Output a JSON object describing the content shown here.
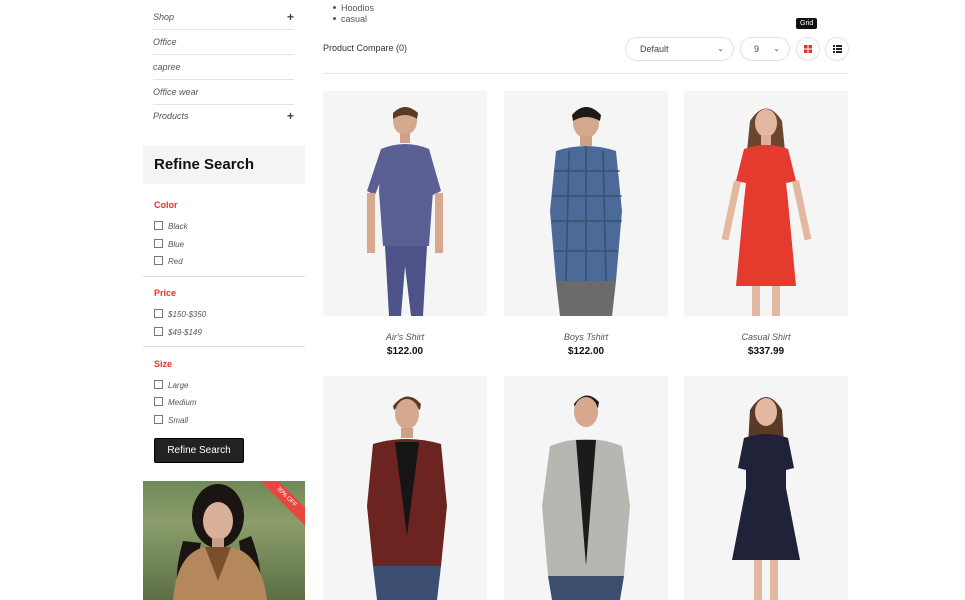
{
  "sidebar": {
    "categories": [
      {
        "label": "Shop",
        "expand": "+"
      },
      {
        "label": "Office",
        "expand": ""
      },
      {
        "label": "capree",
        "expand": ""
      },
      {
        "label": "Office wear",
        "expand": ""
      },
      {
        "label": "Products",
        "expand": "+"
      }
    ],
    "refine_title": "Refine Search",
    "filters": {
      "color": {
        "heading": "Color",
        "options": [
          "Black",
          "Blue",
          "Red"
        ]
      },
      "price": {
        "heading": "Price",
        "options": [
          "$150-$350",
          "$49-$149"
        ]
      },
      "size": {
        "heading": "Size",
        "options": [
          "Large",
          "Medium",
          "Small"
        ]
      }
    },
    "refine_button": "Refine Search",
    "promo_badge": "30% OFF"
  },
  "toolbar": {
    "tags": [
      "Hoodios",
      "casual"
    ],
    "compare": "Product Compare (0)",
    "sort_value": "Default",
    "limit_value": "9",
    "grid_tooltip": "Grid",
    "accent_color": "#e0332f"
  },
  "products": [
    {
      "name": "Air's Shirt",
      "price": "$122.00"
    },
    {
      "name": "Boys Tshirt",
      "price": "$122.00"
    },
    {
      "name": "Casual Shirt",
      "price": "$337.99"
    },
    {
      "name": "",
      "price": ""
    },
    {
      "name": "",
      "price": ""
    },
    {
      "name": "",
      "price": ""
    }
  ]
}
